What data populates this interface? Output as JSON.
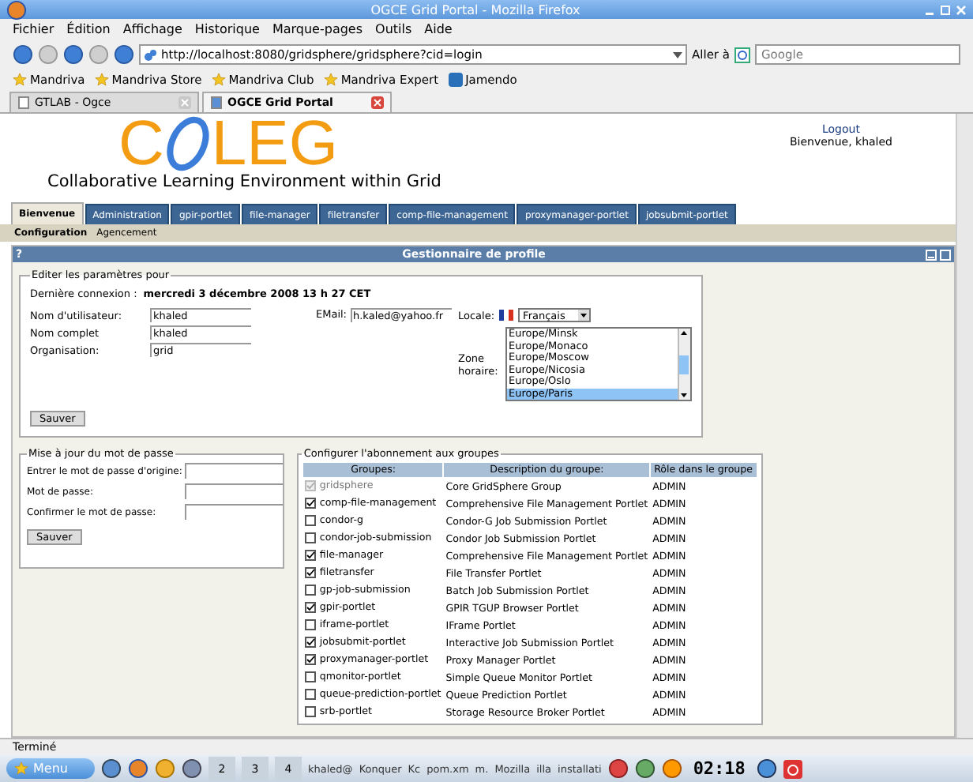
{
  "window": {
    "title": "OGCE Grid Portal - Mozilla Firefox"
  },
  "menu": [
    "Fichier",
    "Édition",
    "Affichage",
    "Historique",
    "Marque-pages",
    "Outils",
    "Aide"
  ],
  "address": {
    "value": "http://localhost:8080/gridsphere/gridsphere?cid=login"
  },
  "go_label": "Aller à",
  "search": {
    "placeholder": "Google"
  },
  "bookmarks": [
    "Mandriva",
    "Mandriva Store",
    "Mandriva Club",
    "Mandriva Expert",
    "Jamendo"
  ],
  "browser_tabs": [
    {
      "label": "GTLAB - Ogce",
      "selected": false
    },
    {
      "label": "OGCE Grid Portal",
      "selected": true
    }
  ],
  "header": {
    "logo_left": "C",
    "logo_right": "LEG",
    "subtitle": "Collaborative Learning Environment within Grid",
    "logout": "Logout",
    "welcome": "Bienvenue, khaled"
  },
  "portal_tabs": [
    {
      "label": "Bienvenue",
      "selected": true
    },
    {
      "label": "Administration",
      "selected": false
    },
    {
      "label": "gpir-portlet",
      "selected": false
    },
    {
      "label": "file-manager",
      "selected": false
    },
    {
      "label": "filetransfer",
      "selected": false
    },
    {
      "label": "comp-file-management",
      "selected": false
    },
    {
      "label": "proxymanager-portlet",
      "selected": false
    },
    {
      "label": "jobsubmit-portlet",
      "selected": false
    }
  ],
  "sub_tabs": [
    {
      "label": "Configuration",
      "selected": true
    },
    {
      "label": "Agencement",
      "selected": false
    }
  ],
  "portlet": {
    "help": "?",
    "title": "Gestionnaire de profile"
  },
  "profile": {
    "legend": "Editer les paramètres pour",
    "last_login_label": "Dernière connexion :",
    "last_login": "mercredi 3 décembre 2008 13 h 27 CET",
    "fields": [
      {
        "label": "Nom d'utilisateur:",
        "value": "khaled"
      },
      {
        "label": "Nom complet",
        "value": "khaled"
      },
      {
        "label": "Organisation:",
        "value": "grid"
      }
    ],
    "email": {
      "label": "EMail:",
      "value": "h.kaled@yahoo.fr"
    },
    "locale": {
      "label": "Locale:",
      "value": "Français"
    },
    "timezone": {
      "label": "Zone horaire:",
      "items": [
        {
          "label": "Europe/Minsk",
          "selected": false
        },
        {
          "label": "Europe/Monaco",
          "selected": false
        },
        {
          "label": "Europe/Moscow",
          "selected": false
        },
        {
          "label": "Europe/Nicosia",
          "selected": false
        },
        {
          "label": "Europe/Oslo",
          "selected": false
        },
        {
          "label": "Europe/Paris",
          "selected": true
        }
      ]
    },
    "save": "Sauver"
  },
  "password": {
    "legend": "Mise à jour du mot de passe",
    "fields": [
      "Entrer le mot de passe d'origine:",
      "Mot de passe:",
      "Confirmer le mot de passe:"
    ],
    "save": "Sauver"
  },
  "groups": {
    "legend": "Configurer l'abonnement aux groupes",
    "columns": [
      "Groupes:",
      "Description du groupe:",
      "Rôle dans le groupe"
    ],
    "rows": [
      {
        "name": "gridsphere",
        "checked": true,
        "disabled": true,
        "description": "Core GridSphere Group",
        "role": "ADMIN"
      },
      {
        "name": "comp-file-management",
        "checked": true,
        "disabled": false,
        "description": "Comprehensive File Management Portlet",
        "role": "ADMIN"
      },
      {
        "name": "condor-g",
        "checked": false,
        "disabled": false,
        "description": "Condor-G Job Submission Portlet",
        "role": "ADMIN"
      },
      {
        "name": "condor-job-submission",
        "checked": false,
        "disabled": false,
        "description": "Condor Job Submission Portlet",
        "role": "ADMIN"
      },
      {
        "name": "file-manager",
        "checked": true,
        "disabled": false,
        "description": "Comprehensive File Management Portlet",
        "role": "ADMIN"
      },
      {
        "name": "filetransfer",
        "checked": true,
        "disabled": false,
        "description": "File Transfer Portlet",
        "role": "ADMIN"
      },
      {
        "name": "gp-job-submission",
        "checked": false,
        "disabled": false,
        "description": "Batch Job Submission Portlet",
        "role": "ADMIN"
      },
      {
        "name": "gpir-portlet",
        "checked": true,
        "disabled": false,
        "description": "GPIR TGUP Browser Portlet",
        "role": "ADMIN"
      },
      {
        "name": "iframe-portlet",
        "checked": false,
        "disabled": false,
        "description": "IFrame Portlet",
        "role": "ADMIN"
      },
      {
        "name": "jobsubmit-portlet",
        "checked": true,
        "disabled": false,
        "description": "Interactive Job Submission Portlet",
        "role": "ADMIN"
      },
      {
        "name": "proxymanager-portlet",
        "checked": true,
        "disabled": false,
        "description": "Proxy Manager Portlet",
        "role": "ADMIN"
      },
      {
        "name": "qmonitor-portlet",
        "checked": false,
        "disabled": false,
        "description": "Simple Queue Monitor Portlet",
        "role": "ADMIN"
      },
      {
        "name": "queue-prediction-portlet",
        "checked": false,
        "disabled": false,
        "description": "Queue Prediction Portlet",
        "role": "ADMIN"
      },
      {
        "name": "srb-portlet",
        "checked": false,
        "disabled": false,
        "description": "Storage Resource Broker Portlet",
        "role": "ADMIN"
      }
    ]
  },
  "status_bar": "Terminé",
  "taskbar": {
    "menu": "Menu",
    "workspaces": [
      {
        "label": "2",
        "selected": false
      },
      {
        "label": "3",
        "selected": false
      },
      {
        "label": "4",
        "selected": false
      }
    ],
    "tasks": [
      "khaled@",
      "Konquer",
      "Kc",
      "pom.xm",
      "m.",
      "Mozilla",
      "illa",
      "installati"
    ],
    "clock": "02:18"
  }
}
